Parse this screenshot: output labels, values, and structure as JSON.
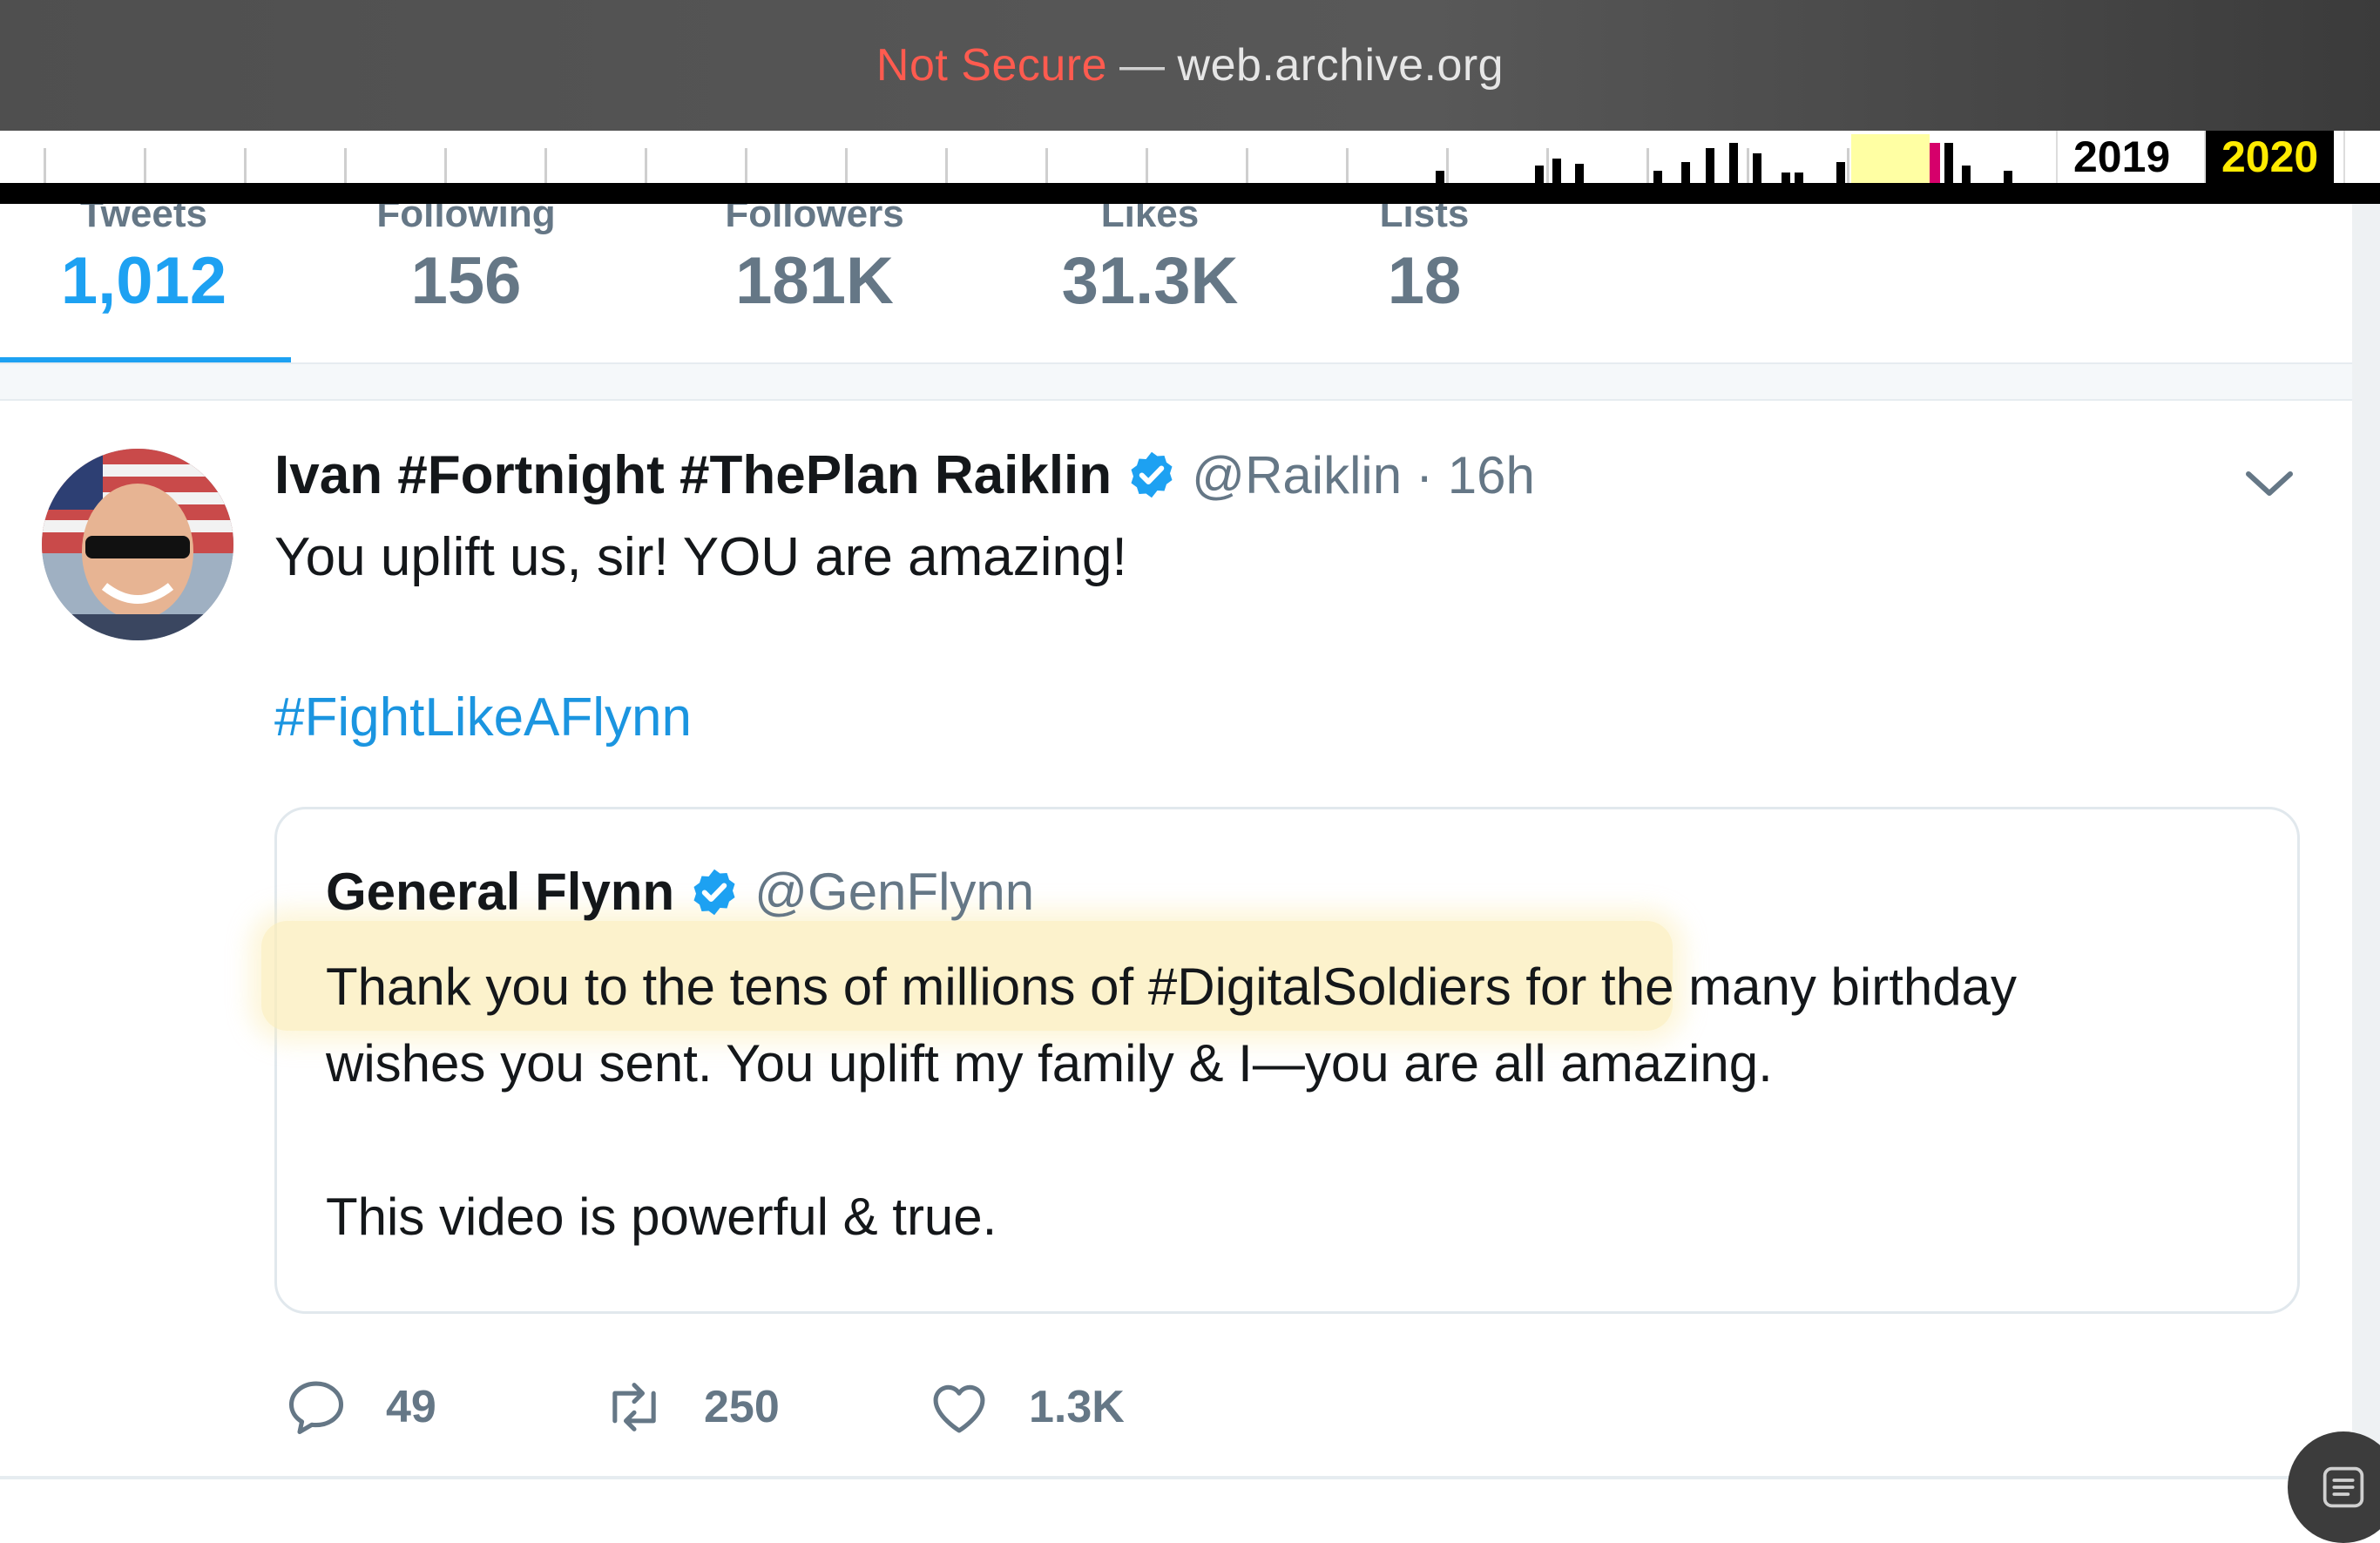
{
  "browser": {
    "security_label": "Not Secure",
    "separator": "—",
    "domain": "web.archive.org"
  },
  "wayback": {
    "years": [
      "2019",
      "2020"
    ],
    "current_year": "2020"
  },
  "profile_stats": [
    {
      "label": "Tweets",
      "value": "1,012",
      "active": true
    },
    {
      "label": "Following",
      "value": "156",
      "active": false
    },
    {
      "label": "Followers",
      "value": "181K",
      "active": false
    },
    {
      "label": "Likes",
      "value": "31.3K",
      "active": false
    },
    {
      "label": "Lists",
      "value": "18",
      "active": false
    }
  ],
  "tweet": {
    "author_name": "Ivan #Fortnight #ThePlan Raiklin",
    "handle": "@Raiklin",
    "time": "· 16h",
    "text": "You uplift us, sir!  YOU are amazing!",
    "hashtag": "#FightLikeAFlynn",
    "quoted": {
      "author_name": "General Flynn",
      "handle": "@GenFlynn",
      "line1": "Thank you to the tens of millions of #DigitalSoldiers for the many birthday",
      "line2": "wishes you sent. You uplift my family & I—you are all amazing.",
      "line3": "This video is powerful & true."
    },
    "actions": {
      "replies": "49",
      "retweets": "250",
      "likes": "1.3K"
    }
  },
  "colors": {
    "accent": "#1da1f2",
    "link": "#1b95e0",
    "muted": "#657786",
    "highlight": "#fbeebb",
    "insecure": "#ff5b4f"
  },
  "icons": {
    "verified": "verified-badge-icon",
    "caret": "chevron-down-icon",
    "reply": "reply-icon",
    "retweet": "retweet-icon",
    "like": "heart-icon",
    "reader": "reader-icon"
  }
}
